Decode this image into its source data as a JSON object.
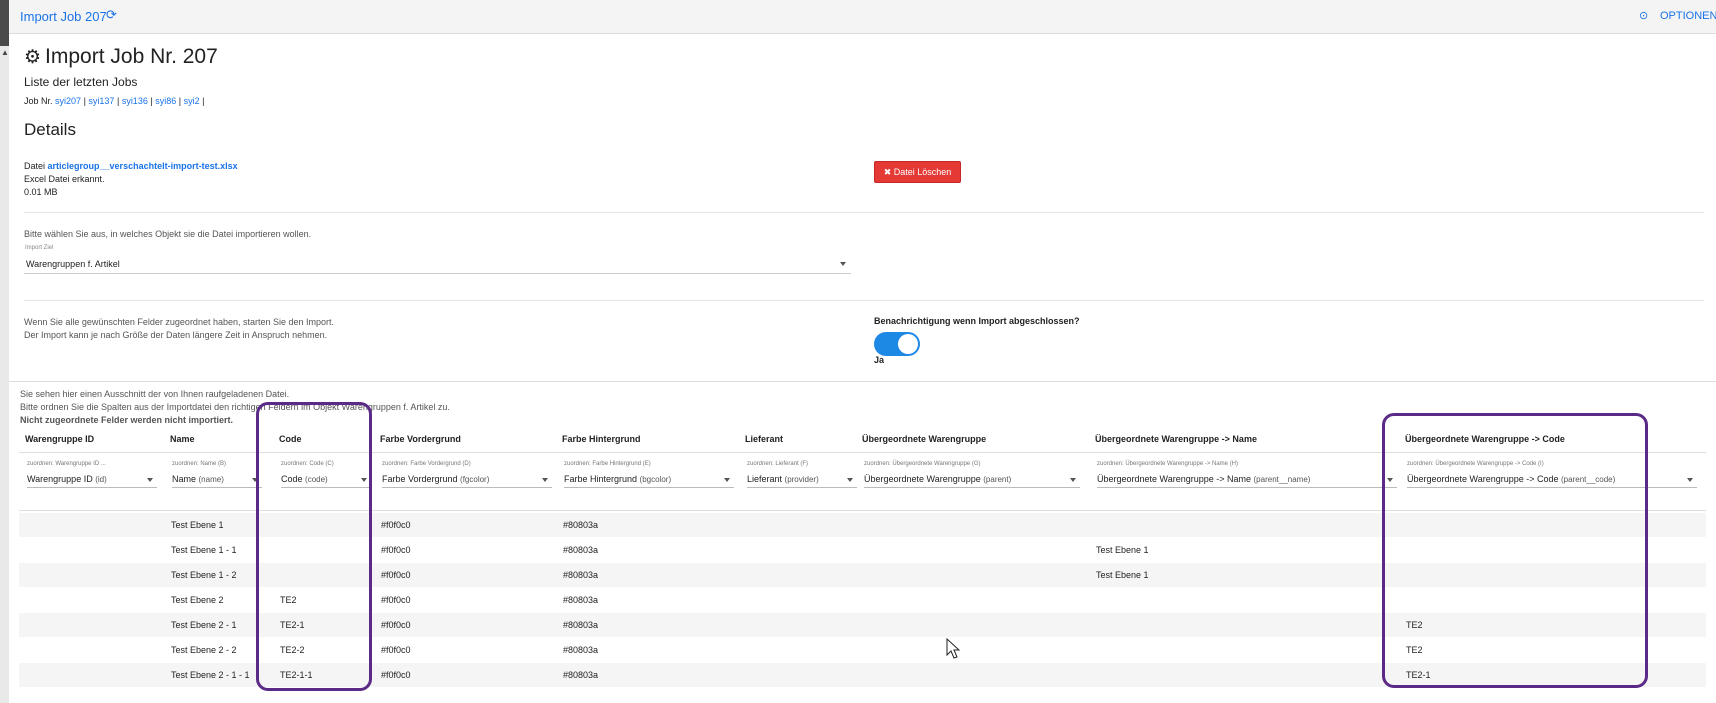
{
  "topbar": {
    "title": "Import Job 207",
    "refresh_icon": "refresh-icon",
    "info_icon": "clock-icon",
    "options_label": "OPTIONEN"
  },
  "page": {
    "heading": "Import Job Nr. 207",
    "subtitle": "Liste der letzten Jobs",
    "jobs_prefix": "Job Nr.",
    "jobs": [
      "syi207",
      "syi137",
      "syi136",
      "syi86",
      "syi2"
    ],
    "separator": "|",
    "details_heading": "Details"
  },
  "file": {
    "prefix": "Datei",
    "name": "articlegroup__verschachtelt-import-test.xlsx",
    "type_text": "Excel Datei erkannt.",
    "size": "0.01 MB",
    "delete_button": "✖ Datei Löschen"
  },
  "target": {
    "prompt": "Bitte wählen Sie aus, in welches Objekt sie die Datei importieren wollen.",
    "label": "Import Ziel",
    "value": "Warengruppen f. Artikel"
  },
  "start": {
    "hint1": "Wenn Sie alle gewünschten Felder zugeordnet haben, starten Sie den Import.",
    "hint2": "Der Import kann je nach Größe der Daten längere Zeit in Anspruch nehmen.",
    "notify_label": "Benachrichtigung wenn Import abgeschlossen?",
    "notify_value": "Ja",
    "notify_on": true
  },
  "intro": {
    "line1": "Sie sehen hier einen Ausschnitt der von Ihnen raufgeladenen Datei.",
    "line2": "Bitte ordnen Sie die Spalten aus der Importdatei den richtigen Feldern im Objekt Warengruppen f. Artikel zu.",
    "line3": "Nicht zugeordnete Felder werden nicht importiert."
  },
  "table": {
    "columns": [
      {
        "header": "Warengruppe ID",
        "map_label": "zuordnen: Warengruppe ID ...",
        "map_value": "Warengruppe ID",
        "map_key": "(id)"
      },
      {
        "header": "Name",
        "map_label": "zuordnen: Name (B)",
        "map_value": "Name",
        "map_key": "(name)"
      },
      {
        "header": "Code",
        "map_label": "zuordnen: Code (C)",
        "map_value": "Code",
        "map_key": "(code)"
      },
      {
        "header": "Farbe Vordergrund",
        "map_label": "zuordnen: Farbe Vordergrund (D)",
        "map_value": "Farbe Vordergrund",
        "map_key": "(fgcolor)"
      },
      {
        "header": "Farbe Hintergrund",
        "map_label": "zuordnen: Farbe Hintergrund (E)",
        "map_value": "Farbe Hintergrund",
        "map_key": "(bgcolor)"
      },
      {
        "header": "Lieferant",
        "map_label": "zuordnen: Lieferant (F)",
        "map_value": "Lieferant",
        "map_key": "(provider)"
      },
      {
        "header": "Übergeordnete Warengruppe",
        "map_label": "zuordnen: Übergeordnete Warengruppe (G)",
        "map_value": "Übergeordnete Warengruppe",
        "map_key": "(parent)"
      },
      {
        "header": "Übergeordnete Warengruppe -> Name",
        "map_label": "zuordnen: Übergeordnete Warengruppe -> Name (H)",
        "map_value": "Übergeordnete Warengruppe -> Name",
        "map_key": "(parent__name)"
      },
      {
        "header": "Übergeordnete Warengruppe -> Code",
        "map_label": "zuordnen: Übergeordnete Warengruppe -> Code (I)",
        "map_value": "Übergeordnete Warengruppe -> Code",
        "map_key": "(parent__code)"
      }
    ],
    "rows": [
      [
        "",
        "Test Ebene 1",
        "",
        "#f0f0c0",
        "#80803a",
        "",
        "",
        "",
        ""
      ],
      [
        "",
        "Test Ebene 1 - 1",
        "",
        "#f0f0c0",
        "#80803a",
        "",
        "",
        "Test Ebene 1",
        ""
      ],
      [
        "",
        "Test Ebene 1 - 2",
        "",
        "#f0f0c0",
        "#80803a",
        "",
        "",
        "Test Ebene 1",
        ""
      ],
      [
        "",
        "Test Ebene 2",
        "TE2",
        "#f0f0c0",
        "#80803a",
        "",
        "",
        "",
        ""
      ],
      [
        "",
        "Test Ebene 2 - 1",
        "TE2-1",
        "#f0f0c0",
        "#80803a",
        "",
        "",
        "",
        "TE2"
      ],
      [
        "",
        "Test Ebene 2 - 2",
        "TE2-2",
        "#f0f0c0",
        "#80803a",
        "",
        "",
        "",
        "TE2"
      ],
      [
        "",
        "Test Ebene 2 - 1 - 1",
        "TE2-1-1",
        "#f0f0c0",
        "#80803a",
        "",
        "",
        "",
        "TE2-1"
      ]
    ]
  },
  "colors": {
    "accent": "#1a73e8",
    "danger": "#e53935",
    "highlight": "#5b2a86",
    "toggle": "#1e88e5"
  }
}
